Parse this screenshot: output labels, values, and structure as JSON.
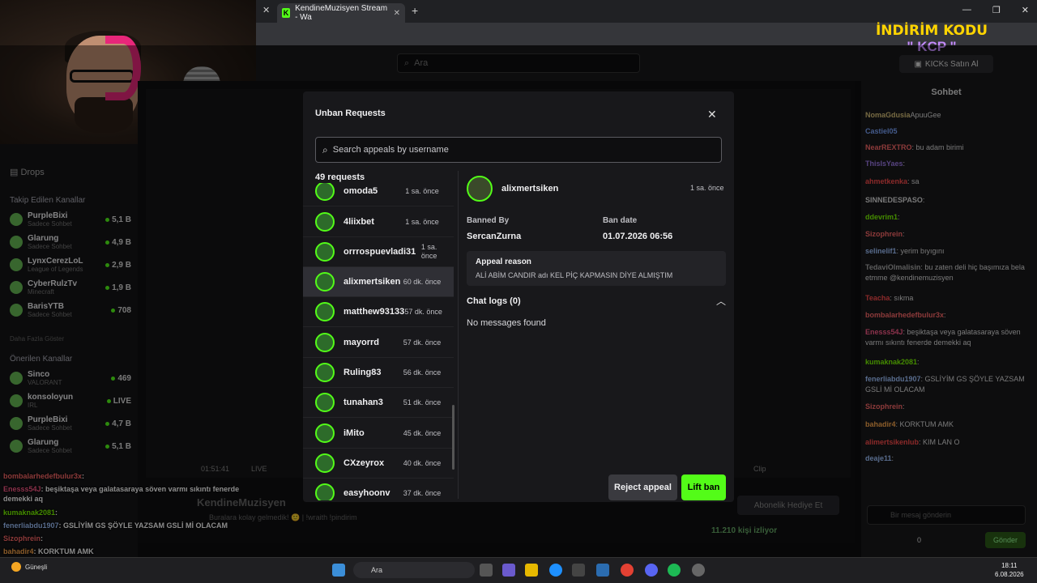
{
  "browser": {
    "tab_title": "KendineMuzisyen Stream - Wa",
    "new_tab_icon": "plus-icon",
    "search_placeholder": "Ara"
  },
  "promo": {
    "code_text": "İNDİRİM KODU",
    "code": "\" KCP \""
  },
  "kick_header": {
    "kicks_button": "KICKs Satın Al"
  },
  "sidebar": {
    "following_header": "Takip Edilen Kanallar",
    "drops": "Drops",
    "following": [
      {
        "name": "PurpleBixi",
        "game": "Sadece Sohbet",
        "viewers": "5,1 B"
      },
      {
        "name": "Glarung",
        "game": "Sadece Sohbet",
        "viewers": "4,9 B"
      },
      {
        "name": "LynxCerezLoL",
        "game": "League of Legends",
        "viewers": "2,9 B"
      },
      {
        "name": "CyberRulzTv",
        "game": "Minecraft",
        "viewers": "1,9 B"
      },
      {
        "name": "BarisYTB",
        "game": "Sadece Sohbet",
        "viewers": "708"
      }
    ],
    "show_more": "Daha Fazla Göster",
    "recommended_header": "Önerilen Kanallar",
    "recommended": [
      {
        "name": "Sinco",
        "game": "VALORANT",
        "viewers": "469"
      },
      {
        "name": "konsoloyun",
        "game": "IRL",
        "viewers": "LIVE"
      },
      {
        "name": "PurpleBixi",
        "game": "Sadece Sohbet",
        "viewers": "4,7 B"
      },
      {
        "name": "Glarung",
        "game": "Sadece Sohbet",
        "viewers": "5,1 B"
      }
    ]
  },
  "stream": {
    "title": "KendineMuzisyen",
    "subtitle": "Buralara kolay gelmedik! 🙂 | !wraith !pindirim",
    "viewers": "11.210 kişi izliyor",
    "subscribe_gift": "Abonelik Hediye Et",
    "time": "01:51:41",
    "live": "LIVE",
    "clip": "Clip"
  },
  "overlay_chat": [
    {
      "user": "bombalarhedefbulur3x",
      "msg": ":",
      "color": "#ff6b6b"
    },
    {
      "user": "Enesss54J",
      "msg": ": beşiktaşa veya galatasaraya söven varmı sıkıntı fenerde demekki aq",
      "color": "#ff5c8a"
    },
    {
      "user": "kumaknak2081",
      "msg": ":",
      "color": "#7CFC00"
    },
    {
      "user": "fenerliabdu1907",
      "msg": ": GSLİYİM GS ŞÖYLE YAZSAM GSLİ Mİ OLACAM",
      "color": "#a0c4ff"
    },
    {
      "user": "Sizophrein",
      "msg": ":",
      "color": "#ff6b6b"
    },
    {
      "user": "bahadir4",
      "msg": ": KORKTUM AMK",
      "color": "#ffa94d"
    },
    {
      "user": "alimertsikenlub",
      "msg": ": KIM LAN O",
      "color": "#ff4d4d"
    }
  ],
  "chat": {
    "title": "Sohbet",
    "lines": [
      {
        "user": "NomaGdusia",
        "msg": "ApuuGee",
        "color": "#d9c27a"
      },
      {
        "user": "Castiel05",
        "msg": "",
        "color": "#7da6ff"
      },
      {
        "user": "NearREXTRO",
        "msg": ": bu adam birimi",
        "color": "#ff6b6b"
      },
      {
        "user": "ThisIsYaes",
        "msg": ":",
        "color": "#9f7aea"
      },
      {
        "user": "ahmetkenka",
        "msg": ": sa",
        "color": "#ff4d4d"
      },
      {
        "user": "SINNEDESPASO",
        "msg": ":",
        "color": "#dddddd"
      },
      {
        "user": "ddevrim1",
        "msg": ":",
        "color": "#7CFC00"
      },
      {
        "user": "Sizophrein",
        "msg": ":",
        "color": "#ff6b6b"
      },
      {
        "user": "selinelif1",
        "msg": ": yerim bıyıgını",
        "color": "#a0c4ff"
      },
      {
        "user": "TedaviOlmalisin",
        "msg": ": bu zaten deli hiç başımıza bela etmme @kendinemuzisyen",
        "color": "#aaaaaa"
      },
      {
        "user": "Teacha",
        "msg": ": sıkma",
        "color": "#ff4d4d"
      },
      {
        "user": "bombalarhedefbulur3x",
        "msg": ":",
        "color": "#ff6b6b"
      },
      {
        "user": "Enesss54J",
        "msg": ": beşiktaşa veya galatasaraya söven varmı sıkıntı fenerde demekki aq",
        "color": "#ff5c8a"
      },
      {
        "user": "kumaknak2081",
        "msg": ":",
        "color": "#7CFC00"
      },
      {
        "user": "fenerliabdu1907",
        "msg": ": GSLİYİM GS ŞÖYLE YAZSAM GSLİ Mİ OLACAM",
        "color": "#a0c4ff"
      },
      {
        "user": "Sizophrein",
        "msg": ":",
        "color": "#ff6b6b"
      },
      {
        "user": "bahadir4",
        "msg": ": KORKTUM AMK",
        "color": "#ffa94d"
      },
      {
        "user": "alimertsikenlub",
        "msg": ": KIM LAN O",
        "color": "#ff4d4d"
      },
      {
        "user": "deaje11",
        "msg": ":",
        "color": "#a0c4ff"
      }
    ],
    "input_placeholder": "Bir mesaj gönderin",
    "send_label": "Gönder",
    "points": "0"
  },
  "modal": {
    "title": "Unban Requests",
    "search_placeholder": "Search appeals by username",
    "count": "49 requests",
    "requests": [
      {
        "name": "omoda5",
        "time": "1 sa. önce"
      },
      {
        "name": "4liixbet",
        "time": "1 sa. önce"
      },
      {
        "name": "orrrospuevladi31",
        "time": "1 sa. önce"
      },
      {
        "name": "alixmertsiken",
        "time": "60 dk. önce"
      },
      {
        "name": "matthew93133",
        "time": "57 dk. önce"
      },
      {
        "name": "mayorrd",
        "time": "57 dk. önce"
      },
      {
        "name": "Ruling83",
        "time": "56 dk. önce"
      },
      {
        "name": "tunahan3",
        "time": "51 dk. önce"
      },
      {
        "name": "iMito",
        "time": "45 dk. önce"
      },
      {
        "name": "CXzeyrox",
        "time": "40 dk. önce"
      },
      {
        "name": "easyhoonv",
        "time": "37 dk. önce"
      }
    ],
    "detail": {
      "name": "alixmertsiken",
      "time": "1 sa. önce",
      "banned_by_label": "Banned By",
      "banned_by": "SercanZurna",
      "ban_date_label": "Ban date",
      "ban_date": "01.07.2026 06:56",
      "appeal_reason_label": "Appeal reason",
      "appeal_reason": "ALİ ABİM CANDIR adı KEL PİÇ KAPMASIN DİYE ALMIŞTIM",
      "chat_logs_label": "Chat logs (0)",
      "no_messages": "No messages found"
    },
    "reject_label": "Reject appeal",
    "lift_label": "Lift ban"
  },
  "taskbar": {
    "search": "Ara",
    "weather": "Güneşli",
    "time": "18:11",
    "date": "6.08.2026"
  }
}
